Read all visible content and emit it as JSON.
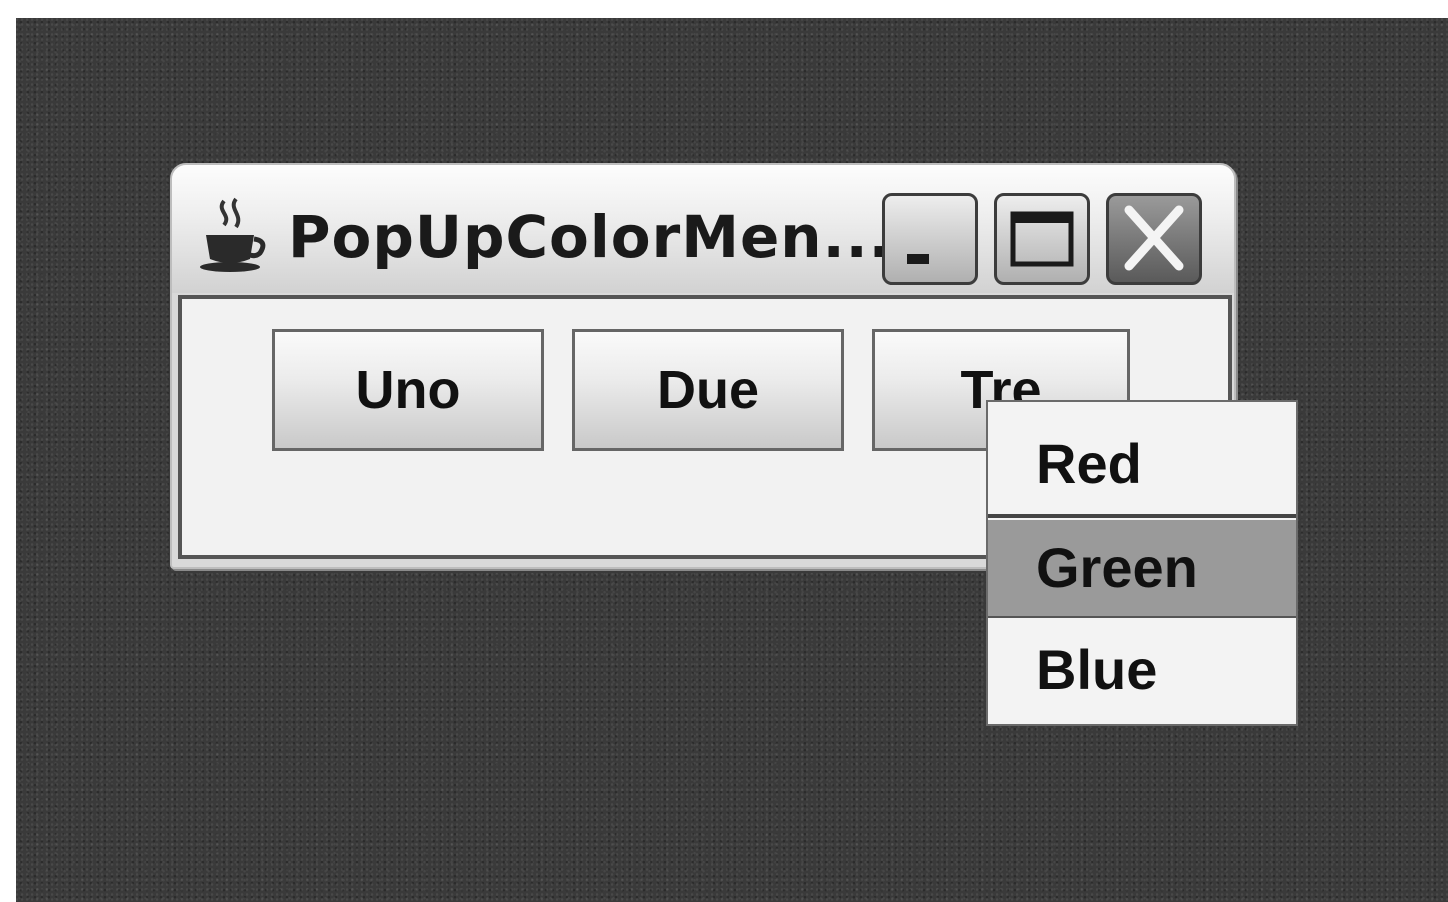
{
  "window": {
    "title": "PopUpColorMen...",
    "app_icon": "java-coffee-cup-icon",
    "controls": {
      "minimize_icon": "minimize-icon",
      "maximize_icon": "maximize-icon",
      "close_icon": "close-icon"
    }
  },
  "buttons": [
    {
      "label": "Uno"
    },
    {
      "label": "Due"
    },
    {
      "label": "Tre"
    }
  ],
  "popup_menu": {
    "items": [
      {
        "label": "Red"
      },
      {
        "label": "Green",
        "highlighted": true
      },
      {
        "label": "Blue"
      }
    ]
  },
  "colors": {
    "desktop": "#3a3a3a",
    "menu_highlight": "#9a9a9a"
  }
}
